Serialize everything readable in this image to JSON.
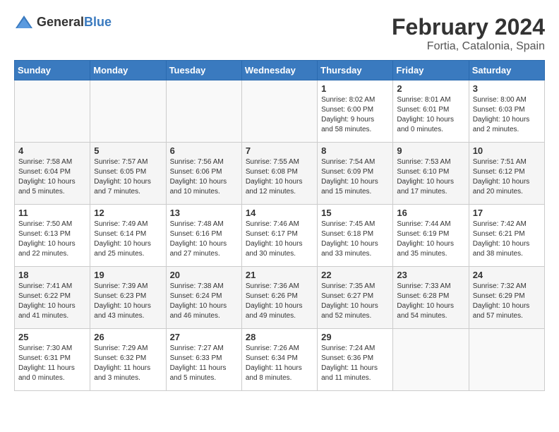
{
  "header": {
    "logo_general": "General",
    "logo_blue": "Blue",
    "month_year": "February 2024",
    "location": "Fortia, Catalonia, Spain"
  },
  "days_of_week": [
    "Sunday",
    "Monday",
    "Tuesday",
    "Wednesday",
    "Thursday",
    "Friday",
    "Saturday"
  ],
  "weeks": [
    [
      {
        "day": "",
        "info": ""
      },
      {
        "day": "",
        "info": ""
      },
      {
        "day": "",
        "info": ""
      },
      {
        "day": "",
        "info": ""
      },
      {
        "day": "1",
        "info": "Sunrise: 8:02 AM\nSunset: 6:00 PM\nDaylight: 9 hours\nand 58 minutes."
      },
      {
        "day": "2",
        "info": "Sunrise: 8:01 AM\nSunset: 6:01 PM\nDaylight: 10 hours\nand 0 minutes."
      },
      {
        "day": "3",
        "info": "Sunrise: 8:00 AM\nSunset: 6:03 PM\nDaylight: 10 hours\nand 2 minutes."
      }
    ],
    [
      {
        "day": "4",
        "info": "Sunrise: 7:58 AM\nSunset: 6:04 PM\nDaylight: 10 hours\nand 5 minutes."
      },
      {
        "day": "5",
        "info": "Sunrise: 7:57 AM\nSunset: 6:05 PM\nDaylight: 10 hours\nand 7 minutes."
      },
      {
        "day": "6",
        "info": "Sunrise: 7:56 AM\nSunset: 6:06 PM\nDaylight: 10 hours\nand 10 minutes."
      },
      {
        "day": "7",
        "info": "Sunrise: 7:55 AM\nSunset: 6:08 PM\nDaylight: 10 hours\nand 12 minutes."
      },
      {
        "day": "8",
        "info": "Sunrise: 7:54 AM\nSunset: 6:09 PM\nDaylight: 10 hours\nand 15 minutes."
      },
      {
        "day": "9",
        "info": "Sunrise: 7:53 AM\nSunset: 6:10 PM\nDaylight: 10 hours\nand 17 minutes."
      },
      {
        "day": "10",
        "info": "Sunrise: 7:51 AM\nSunset: 6:12 PM\nDaylight: 10 hours\nand 20 minutes."
      }
    ],
    [
      {
        "day": "11",
        "info": "Sunrise: 7:50 AM\nSunset: 6:13 PM\nDaylight: 10 hours\nand 22 minutes."
      },
      {
        "day": "12",
        "info": "Sunrise: 7:49 AM\nSunset: 6:14 PM\nDaylight: 10 hours\nand 25 minutes."
      },
      {
        "day": "13",
        "info": "Sunrise: 7:48 AM\nSunset: 6:16 PM\nDaylight: 10 hours\nand 27 minutes."
      },
      {
        "day": "14",
        "info": "Sunrise: 7:46 AM\nSunset: 6:17 PM\nDaylight: 10 hours\nand 30 minutes."
      },
      {
        "day": "15",
        "info": "Sunrise: 7:45 AM\nSunset: 6:18 PM\nDaylight: 10 hours\nand 33 minutes."
      },
      {
        "day": "16",
        "info": "Sunrise: 7:44 AM\nSunset: 6:19 PM\nDaylight: 10 hours\nand 35 minutes."
      },
      {
        "day": "17",
        "info": "Sunrise: 7:42 AM\nSunset: 6:21 PM\nDaylight: 10 hours\nand 38 minutes."
      }
    ],
    [
      {
        "day": "18",
        "info": "Sunrise: 7:41 AM\nSunset: 6:22 PM\nDaylight: 10 hours\nand 41 minutes."
      },
      {
        "day": "19",
        "info": "Sunrise: 7:39 AM\nSunset: 6:23 PM\nDaylight: 10 hours\nand 43 minutes."
      },
      {
        "day": "20",
        "info": "Sunrise: 7:38 AM\nSunset: 6:24 PM\nDaylight: 10 hours\nand 46 minutes."
      },
      {
        "day": "21",
        "info": "Sunrise: 7:36 AM\nSunset: 6:26 PM\nDaylight: 10 hours\nand 49 minutes."
      },
      {
        "day": "22",
        "info": "Sunrise: 7:35 AM\nSunset: 6:27 PM\nDaylight: 10 hours\nand 52 minutes."
      },
      {
        "day": "23",
        "info": "Sunrise: 7:33 AM\nSunset: 6:28 PM\nDaylight: 10 hours\nand 54 minutes."
      },
      {
        "day": "24",
        "info": "Sunrise: 7:32 AM\nSunset: 6:29 PM\nDaylight: 10 hours\nand 57 minutes."
      }
    ],
    [
      {
        "day": "25",
        "info": "Sunrise: 7:30 AM\nSunset: 6:31 PM\nDaylight: 11 hours\nand 0 minutes."
      },
      {
        "day": "26",
        "info": "Sunrise: 7:29 AM\nSunset: 6:32 PM\nDaylight: 11 hours\nand 3 minutes."
      },
      {
        "day": "27",
        "info": "Sunrise: 7:27 AM\nSunset: 6:33 PM\nDaylight: 11 hours\nand 5 minutes."
      },
      {
        "day": "28",
        "info": "Sunrise: 7:26 AM\nSunset: 6:34 PM\nDaylight: 11 hours\nand 8 minutes."
      },
      {
        "day": "29",
        "info": "Sunrise: 7:24 AM\nSunset: 6:36 PM\nDaylight: 11 hours\nand 11 minutes."
      },
      {
        "day": "",
        "info": ""
      },
      {
        "day": "",
        "info": ""
      }
    ]
  ]
}
